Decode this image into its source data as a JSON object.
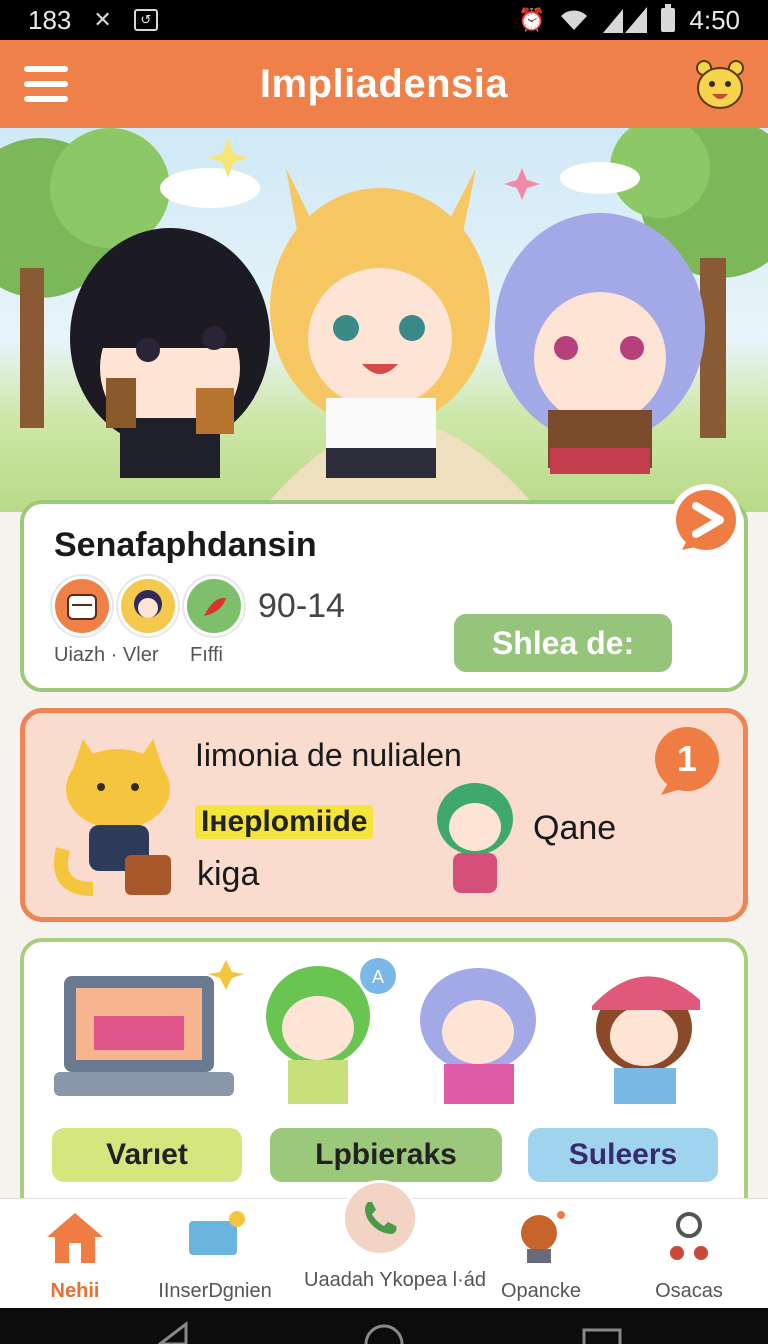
{
  "status_bar": {
    "time_left": "183",
    "time_right": "4:50"
  },
  "app_bar": {
    "title": "Impliadensia"
  },
  "card_featured": {
    "title": "Senafaphdansin",
    "count": "90-14",
    "avatar_labels": [
      "Uiazh · Vler",
      "Fıffi"
    ],
    "share_button": "Shlea de:"
  },
  "card_event": {
    "headline": "Iimonia de nulialen",
    "highlight": "Iнeplomiide",
    "subtext": "kiga",
    "side_name": "Qane",
    "badge": "1"
  },
  "card_grid": {
    "buttons": [
      "Varıet",
      "Lpbieraks",
      "Suleers"
    ]
  },
  "bottom_nav": [
    {
      "label": "Nehii",
      "icon": "home-icon"
    },
    {
      "label": "IInserDgnien",
      "icon": "monitor-icon"
    },
    {
      "label": "Uaadah Ykopea l·ád",
      "icon": "phone-icon"
    },
    {
      "label": "Opancke",
      "icon": "character-icon"
    },
    {
      "label": "Osacas",
      "icon": "person-icon"
    }
  ],
  "colors": {
    "primary": "#f08049",
    "green": "#9cc87c",
    "blue": "#9fd3ee",
    "lime": "#d6e67f",
    "event_bg": "#f9dccd"
  }
}
